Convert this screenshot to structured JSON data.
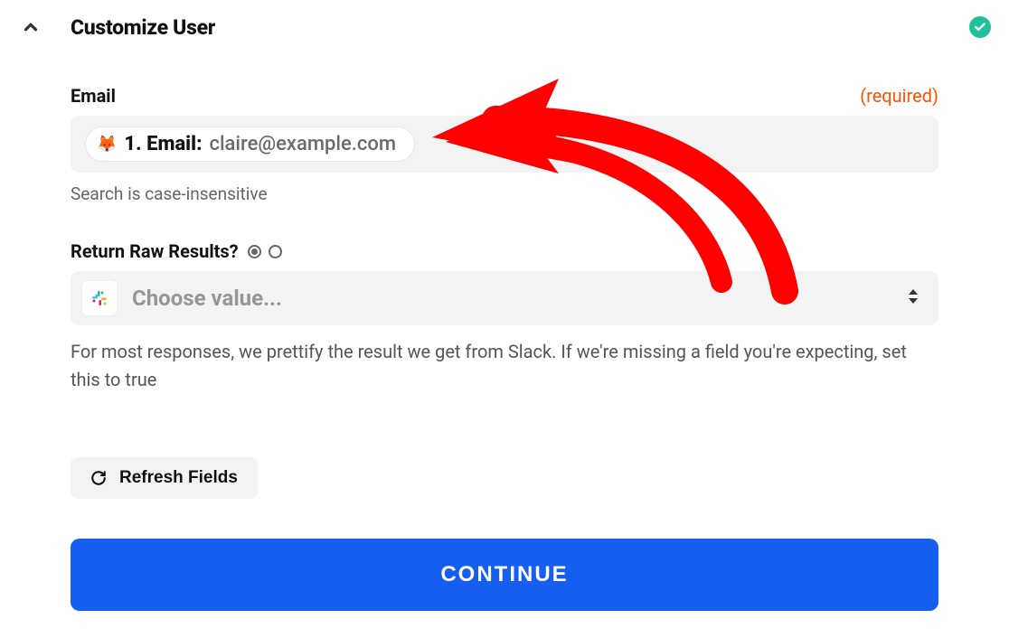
{
  "header": {
    "title": "Customize User"
  },
  "email_field": {
    "label": "Email",
    "required_text": "(required)",
    "pill_prefix": "1. Email:",
    "pill_value": "claire@example.com",
    "helper": "Search is case-insensitive"
  },
  "raw_results": {
    "label": "Return Raw Results?",
    "select_placeholder": "Choose value...",
    "description": "For most responses, we prettify the result we get from Slack. If we're missing a field you're expecting, set this to true"
  },
  "buttons": {
    "refresh": "Refresh Fields",
    "continue": "CONTINUE"
  },
  "icons": {
    "pill_emoji": "🦊",
    "slack": "slack"
  }
}
